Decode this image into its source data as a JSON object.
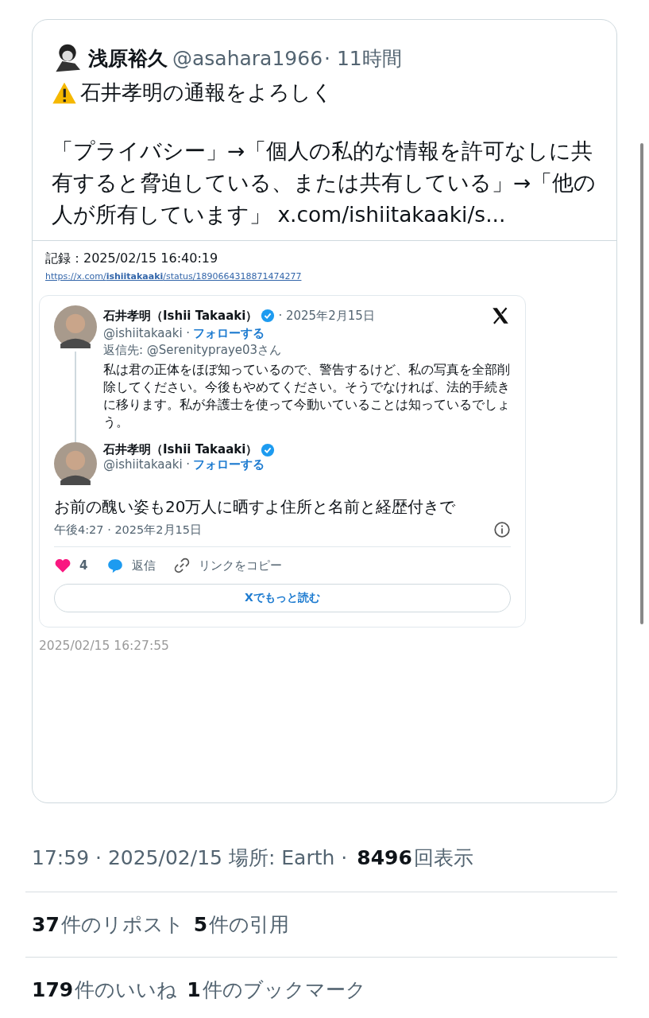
{
  "post": {
    "author": "浅原裕久",
    "handle": "@asahara1966",
    "time": "· 11時間",
    "headline": "石井孝明の通報をよろしく",
    "text": "「プライバシー」→「個人の私的な情報を許可なしに共有すると脅迫している、または共有している」→「他の人が所有しています」 x.com/ishiitakaaki/s...",
    "archive": {
      "label": "記録：2025/02/15 16:40:19",
      "url": "https://x.com/**ishiitakaaki**/status/1890664318871474277"
    },
    "embed": {
      "parent": {
        "name": "石井孝明（Ishii Takaaki）",
        "verified": true,
        "date": "· 2025年2月15日",
        "handle": "@ishiitakaaki ·",
        "follow": "フォローする",
        "reply_to": "返信先: @Serenitypraye03さん",
        "text": "私は君の正体をほぼ知っているので、警告するけど、私の写真を全部削除してください。今後もやめてください。そうでなければ、法的手続きに移ります。私が弁護士を使って今動いていることは知っているでしょう。"
      },
      "reply": {
        "name": "石井孝明（Ishii Takaaki）",
        "verified": true,
        "handle": "@ishiitakaaki ·",
        "follow": "フォローする",
        "text": "お前の醜い姿も20万人に晒すよ住所と名前と経歴付きで",
        "time": "午後4:27 · 2025年2月15日"
      },
      "actions": {
        "likes": "4",
        "reply": "返信",
        "copy": "リンクをコピー"
      },
      "read_more": "Xでもっと読む"
    },
    "captured": "2025/02/15 16:27:55"
  },
  "stats": {
    "meta": "17:59 · 2025/02/15 場所: Earth ·",
    "rows": [
      [
        {
          "count": "8496",
          "label": "回表示"
        }
      ],
      [
        {
          "count": "37",
          "label": "件のリポスト"
        },
        {
          "count": "5",
          "label": "件の引用"
        }
      ],
      [
        {
          "count": "179",
          "label": "件のいいね"
        },
        {
          "count": "1",
          "label": "件のブックマーク"
        }
      ]
    ]
  }
}
